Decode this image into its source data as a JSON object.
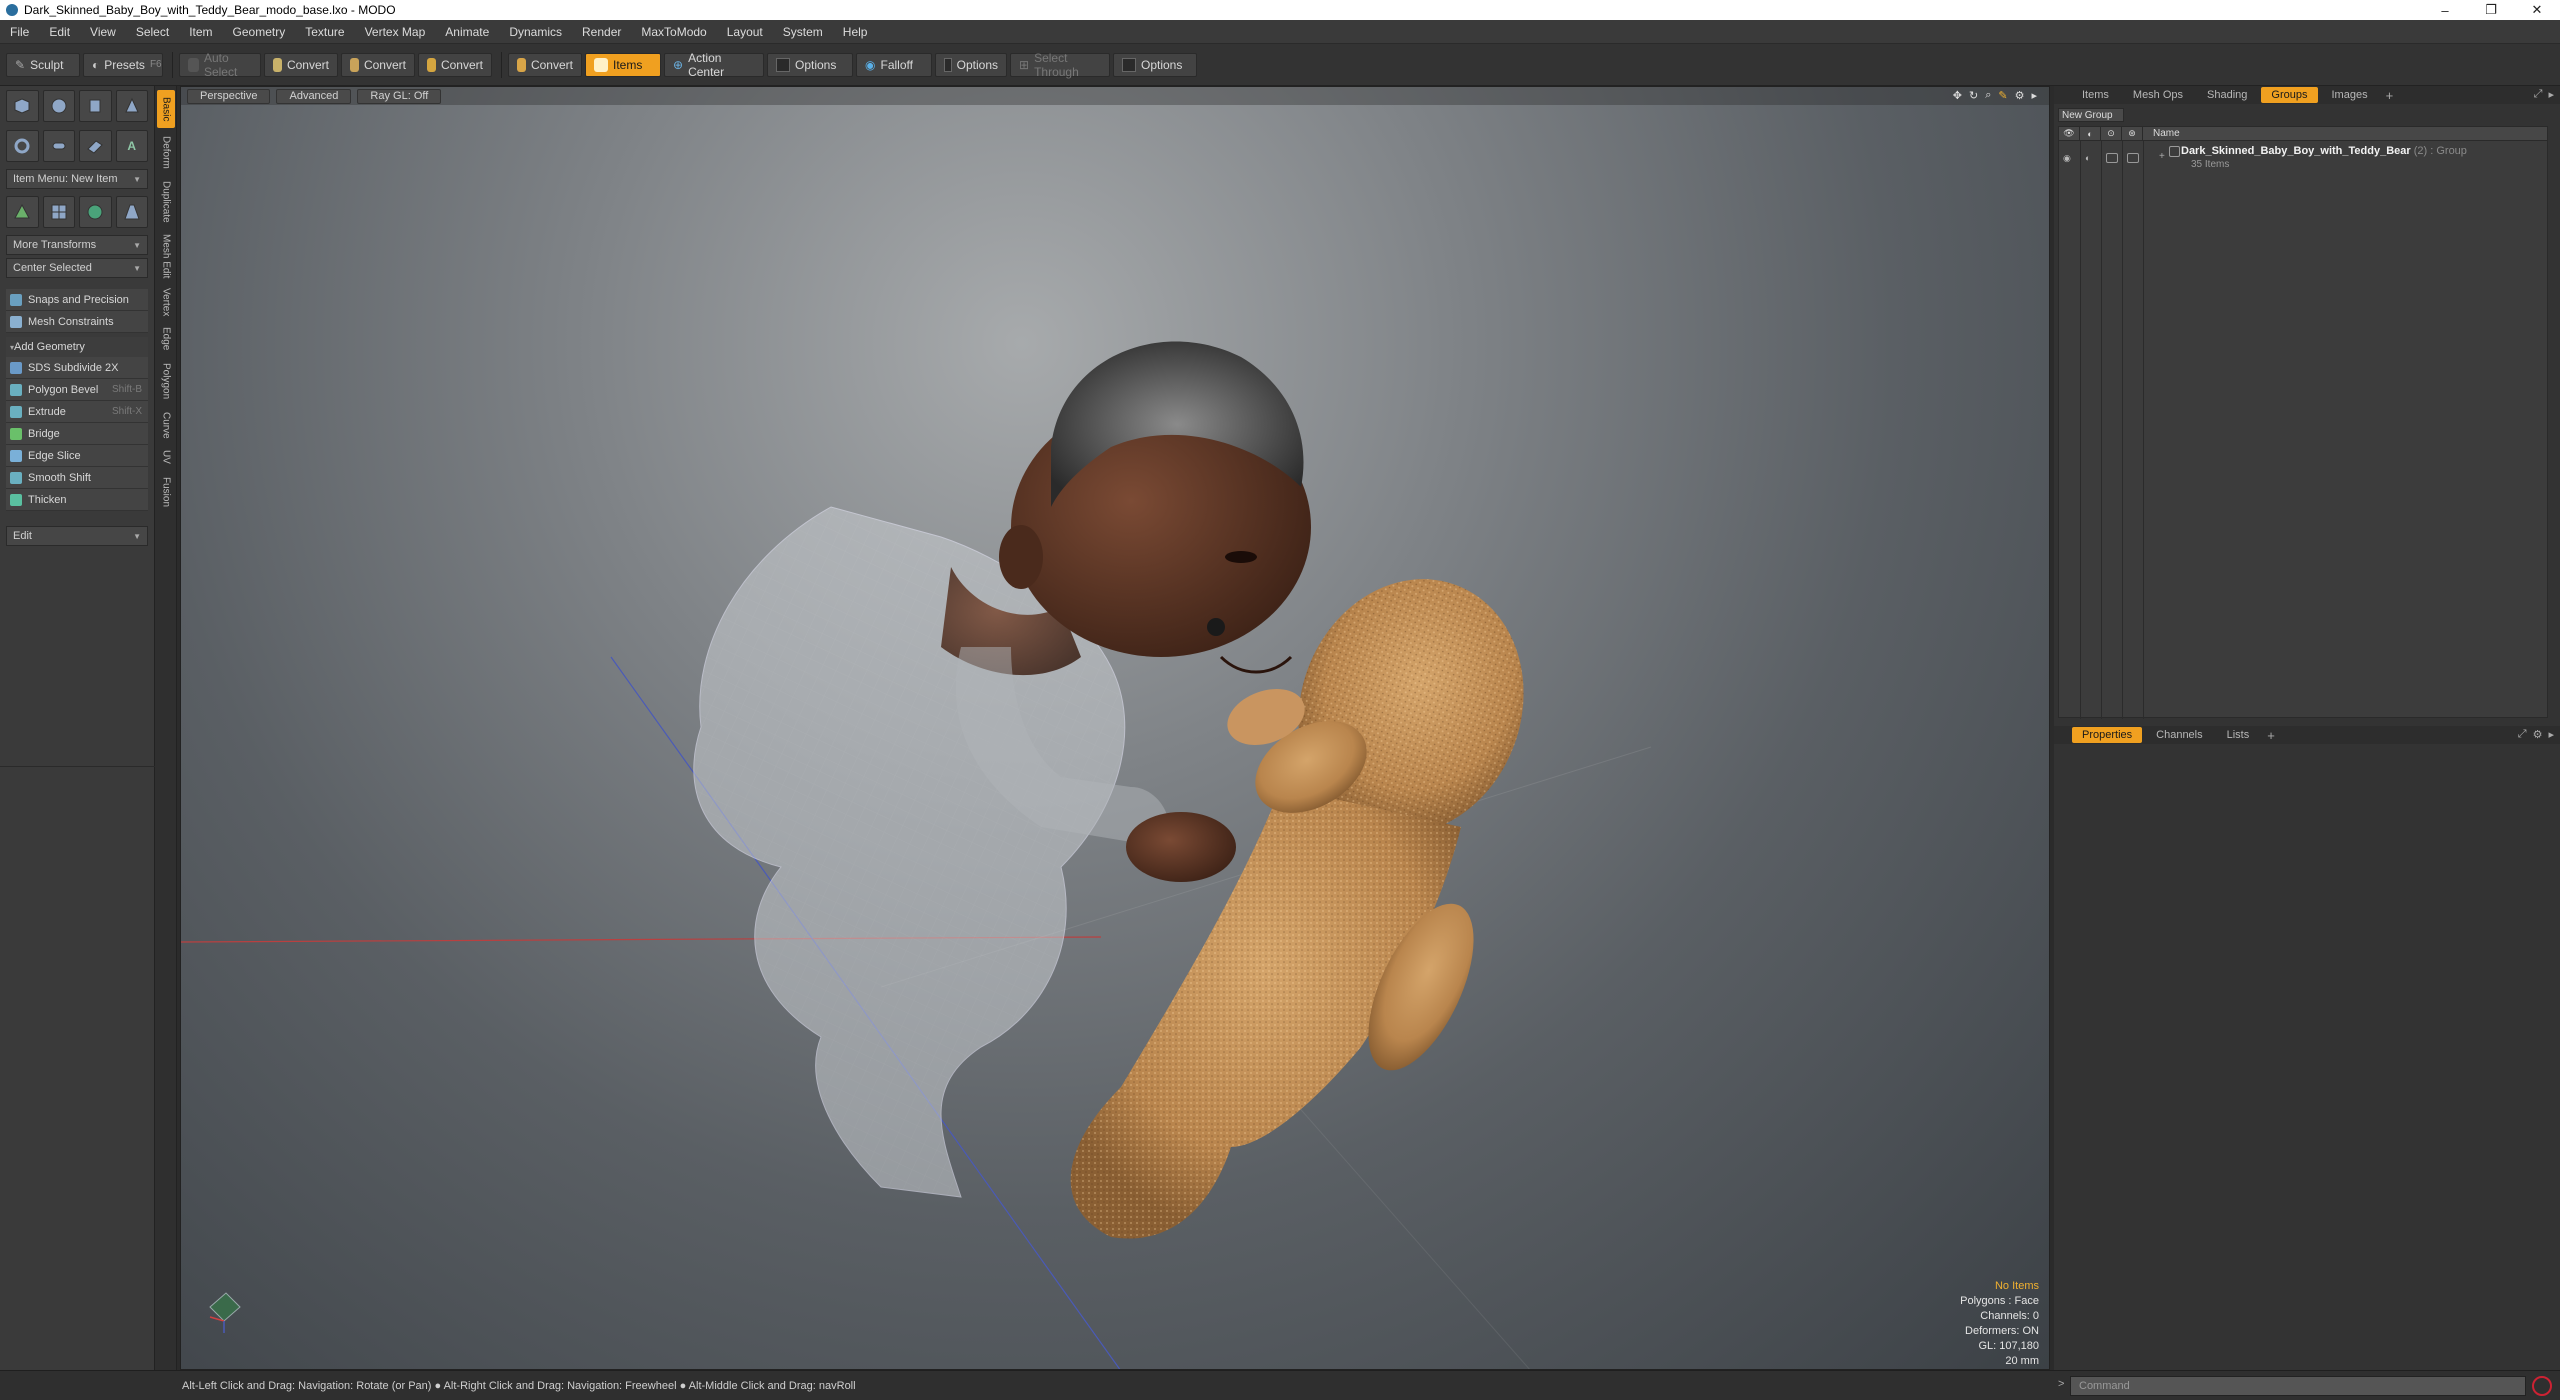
{
  "window": {
    "title": "Dark_Skinned_Baby_Boy_with_Teddy_Bear_modo_base.lxo - MODO",
    "minimize": "–",
    "maximize": "❐",
    "close": "✕"
  },
  "menubar": {
    "items": [
      "File",
      "Edit",
      "View",
      "Select",
      "Item",
      "Geometry",
      "Texture",
      "Vertex Map",
      "Animate",
      "Dynamics",
      "Render",
      "MaxToModo",
      "Layout",
      "System",
      "Help"
    ]
  },
  "toolbar": {
    "sculpt": "Sculpt",
    "presets": "Presets",
    "presets_shortcut": "F6",
    "auto_select": "Auto Select",
    "convert1": "Convert",
    "convert2": "Convert",
    "convert3": "Convert",
    "convert4": "Convert",
    "items": "Items",
    "action_center": "Action Center",
    "options1": "Options",
    "falloff": "Falloff",
    "options2": "Options",
    "select_through": "Select Through",
    "options3": "Options"
  },
  "toolbox": {
    "item_menu": "Item Menu: New Item",
    "more_transforms": "More Transforms",
    "center_selected": "Center Selected",
    "snaps": "Snaps and Precision",
    "mesh_constraints": "Mesh Constraints",
    "add_geometry": "Add Geometry",
    "tools": [
      {
        "label": "SDS Subdivide 2X",
        "shortcut": ""
      },
      {
        "label": "Polygon Bevel",
        "shortcut": "Shift-B"
      },
      {
        "label": "Extrude",
        "shortcut": "Shift-X"
      },
      {
        "label": "Bridge",
        "shortcut": ""
      },
      {
        "label": "Edge Slice",
        "shortcut": ""
      },
      {
        "label": "Smooth Shift",
        "shortcut": ""
      },
      {
        "label": "Thicken",
        "shortcut": ""
      }
    ],
    "edit": "Edit",
    "vtabs": [
      "Basic",
      "Deform",
      "Duplicate",
      "Mesh Edit",
      "Vertex",
      "Edge",
      "Polygon",
      "Curve",
      "UV",
      "Fusion"
    ]
  },
  "viewport": {
    "tabs": [
      "Perspective",
      "Advanced",
      "Ray GL: Off"
    ],
    "stats": {
      "no_items": "No Items",
      "polygons": "Polygons : Face",
      "channels": "Channels: 0",
      "deformers": "Deformers: ON",
      "gl": "GL: 107,180",
      "scale": "20 mm"
    }
  },
  "statusbar": {
    "hint": "Alt-Left Click and Drag: Navigation: Rotate (or Pan) ● Alt-Right Click and Drag: Navigation: Freewheel ● Alt-Middle Click and Drag: navRoll",
    "command_placeholder": "Command",
    "prompt": ">"
  },
  "rightpanel": {
    "tabs": [
      "Items",
      "Mesh Ops",
      "Shading",
      "Groups",
      "Images"
    ],
    "active_tab": "Groups",
    "new_group": "New Group",
    "name_col": "Name",
    "group": {
      "name": "Dark_Skinned_Baby_Boy_with_Teddy_Bear",
      "type": "(2) : Group",
      "sub": "35 Items"
    },
    "bottom_tabs": [
      "Properties",
      "Channels",
      "Lists"
    ]
  },
  "colors": {
    "accent": "#f0a020",
    "teddy": "#b9854d",
    "skin": "#5a3324"
  }
}
